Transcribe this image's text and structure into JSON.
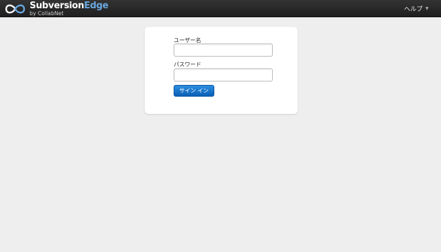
{
  "header": {
    "brand_name_part1": "Subversion",
    "brand_name_part2": "Edge",
    "brand_byline": "by CollabNet",
    "help_label": "ヘルプ",
    "help_icon": "chevron-down-icon"
  },
  "login_form": {
    "username_label": "ユーザー名",
    "username_value": "",
    "password_label": "パスワード",
    "password_value": "",
    "signin_label": "サイン イン"
  },
  "colors": {
    "topbar": "#262626",
    "page_background": "#eeeeee",
    "brand_accent": "#6aa8e0",
    "button": "#1a73cc"
  }
}
